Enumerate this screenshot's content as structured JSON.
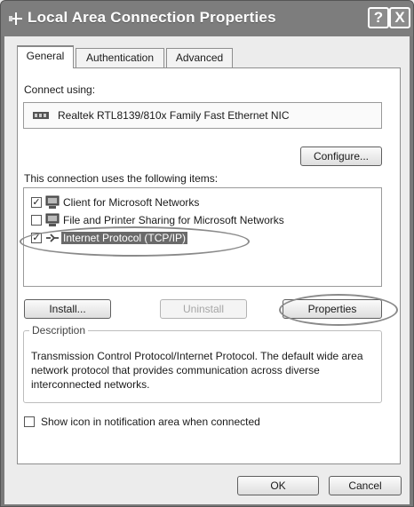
{
  "window": {
    "title": "Local Area Connection Properties",
    "help_label": "?",
    "close_label": "X"
  },
  "tabs": [
    {
      "label": "General",
      "active": true
    },
    {
      "label": "Authentication",
      "active": false
    },
    {
      "label": "Advanced",
      "active": false
    }
  ],
  "connect_using": {
    "label": "Connect using:",
    "adapter": "Realtek RTL8139/810x Family Fast Ethernet NIC",
    "configure_button": "Configure..."
  },
  "items": {
    "label": "This connection uses the following items:",
    "list": [
      {
        "label": "Client for Microsoft Networks",
        "checked": true,
        "selected": false,
        "icon": "network-client-icon"
      },
      {
        "label": "File and Printer Sharing for Microsoft Networks",
        "checked": false,
        "selected": false,
        "icon": "file-printer-sharing-icon"
      },
      {
        "label": "Internet Protocol (TCP/IP)",
        "checked": true,
        "selected": true,
        "icon": "protocol-icon"
      }
    ]
  },
  "buttons": {
    "install": "Install...",
    "uninstall": "Uninstall",
    "properties": "Properties",
    "ok": "OK",
    "cancel": "Cancel"
  },
  "description": {
    "title": "Description",
    "text": "Transmission Control Protocol/Internet Protocol. The default wide area network protocol that provides communication across diverse interconnected networks."
  },
  "show_icon": {
    "label": "Show icon in notification area when connected",
    "checked": false
  },
  "colors": {
    "selection": "#6a6a6a",
    "titlebar": "#7d7d7d"
  }
}
